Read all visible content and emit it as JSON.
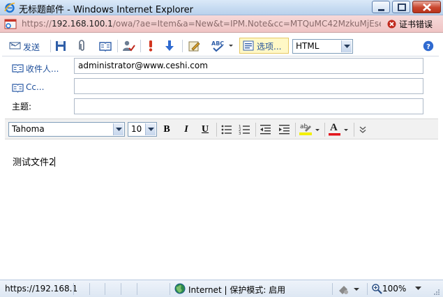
{
  "window": {
    "title": "无标题邮件 - Windows Internet Explorer"
  },
  "address_bar": {
    "url_prefix": "https://",
    "url_host": "192.168.100.1",
    "url_rest": "/owa/?ae=Item&a=New&t=IPM.Note&cc=MTQuMC42MzkuMjEser",
    "cert_error": "证书错误"
  },
  "toolbar": {
    "send_label": "发送",
    "options_label": "选项...",
    "format_value": "HTML"
  },
  "fields": {
    "to_label": "收件人...",
    "to_value": "administrator@www.ceshi.com",
    "cc_label": "Cc...",
    "cc_value": "",
    "subject_label": "主题:",
    "subject_value": ""
  },
  "editor": {
    "font_name": "Tahoma",
    "font_size": "10",
    "bold": "B",
    "italic": "I",
    "underline": "U",
    "font_color_letter": "A",
    "highlight_letters": "ab"
  },
  "body": {
    "text": "测试文件2"
  },
  "status_bar": {
    "url": "https://192.168.1",
    "zone": "Internet | 保护模式: 启用",
    "zoom": "100%"
  },
  "colors": {
    "title_bar": "#c5daf1",
    "address_bar_error": "#efc4c4",
    "link_blue": "#1f4f9a",
    "options_highlight": "#fff8c6"
  }
}
